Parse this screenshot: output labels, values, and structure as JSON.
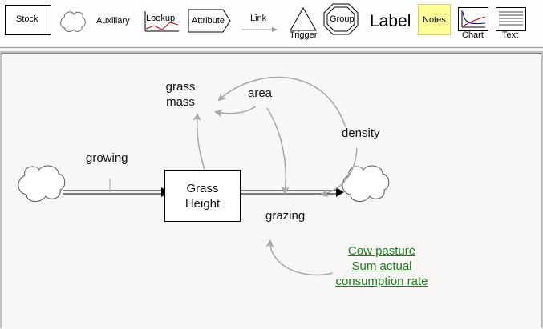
{
  "toolbar": {
    "stock": "Stock",
    "auxiliary": "Auxiliary",
    "lookup": "Lookup",
    "attribute": "Attribute",
    "link": "Link",
    "trigger": "Trigger",
    "group": "Group",
    "label": "Label",
    "notes": "Notes",
    "chart": "Chart",
    "text": "Text"
  },
  "model": {
    "stock": {
      "line1": "Grass",
      "line2": "Height"
    },
    "aux_grass_mass": {
      "line1": "grass",
      "line2": "mass"
    },
    "aux_area": "area",
    "aux_density": "density",
    "flow_growing": "growing",
    "flow_grazing": "grazing",
    "note": {
      "line1": "Cow  pasture",
      "line2": "Sum actual",
      "line3": "consumption rate"
    }
  },
  "colors": {
    "link_arrow": "#a6a6a6",
    "note_text": "#1a7f1a",
    "notes_bg": "#ffff99",
    "canvas_bg": "#f9f7f6"
  }
}
